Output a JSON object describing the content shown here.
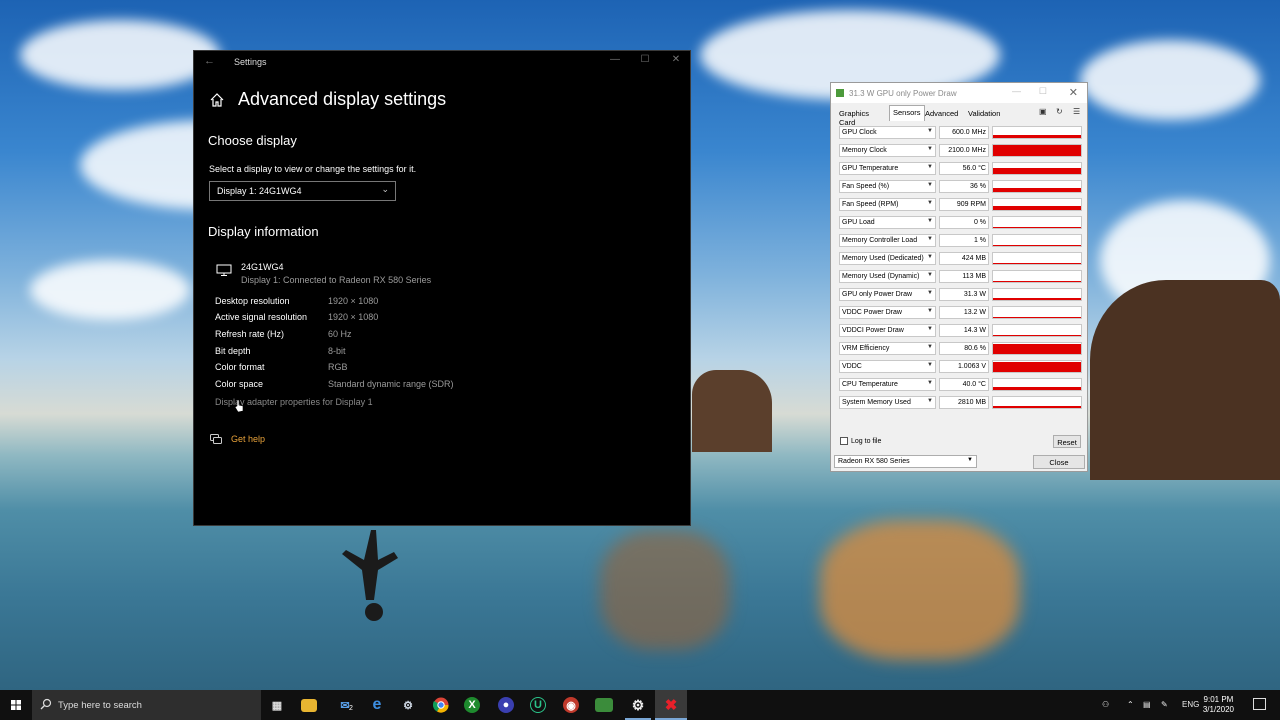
{
  "settings": {
    "window_title": "Settings",
    "page_title": "Advanced display settings",
    "choose_display_heading": "Choose display",
    "choose_display_desc": "Select a display to view or change the settings for it.",
    "display_select_value": "Display 1: 24G1WG4",
    "display_info_heading": "Display information",
    "monitor_name": "24G1WG4",
    "monitor_desc": "Display 1: Connected to Radeon RX 580 Series",
    "info_rows": [
      {
        "label": "Desktop resolution",
        "value": "1920 × 1080"
      },
      {
        "label": "Active signal resolution",
        "value": "1920 × 1080"
      },
      {
        "label": "Refresh rate (Hz)",
        "value": "60 Hz"
      },
      {
        "label": "Bit depth",
        "value": "8-bit"
      },
      {
        "label": "Color format",
        "value": "RGB"
      },
      {
        "label": "Color space",
        "value": "Standard dynamic range (SDR)"
      }
    ],
    "adapter_link": "Display adapter properties for Display 1",
    "get_help": "Get help"
  },
  "gpuz": {
    "title": "31.3 W GPU only Power Draw",
    "tabs": [
      "Graphics Card",
      "Sensors",
      "Advanced",
      "Validation"
    ],
    "active_tab": "Sensors",
    "sensors": [
      {
        "name": "GPU Clock",
        "value": "600.0 MHz",
        "level": 0.3
      },
      {
        "name": "Memory Clock",
        "value": "2100.0 MHz",
        "level": 1.0
      },
      {
        "name": "GPU Temperature",
        "value": "56.0 °C",
        "level": 0.55
      },
      {
        "name": "Fan Speed (%)",
        "value": "36 %",
        "level": 0.35
      },
      {
        "name": "Fan Speed (RPM)",
        "value": "909 RPM",
        "level": 0.35
      },
      {
        "name": "GPU Load",
        "value": "0 %",
        "level": 0.05
      },
      {
        "name": "Memory Controller Load",
        "value": "1 %",
        "level": 0.03
      },
      {
        "name": "Memory Used (Dedicated)",
        "value": "424 MB",
        "level": 0.08
      },
      {
        "name": "Memory Used (Dynamic)",
        "value": "113 MB",
        "level": 0.05
      },
      {
        "name": "GPU only Power Draw",
        "value": "31.3 W",
        "level": 0.2
      },
      {
        "name": "VDDC Power Draw",
        "value": "13.2 W",
        "level": 0.1
      },
      {
        "name": "VDDCI Power Draw",
        "value": "14.3 W",
        "level": 0.1
      },
      {
        "name": "VRM Efficiency",
        "value": "80.6 %",
        "level": 0.95
      },
      {
        "name": "VDDC",
        "value": "1.0063 V",
        "level": 0.9
      },
      {
        "name": "CPU Temperature",
        "value": "40.0 °C",
        "level": 0.3
      },
      {
        "name": "System Memory Used",
        "value": "2810 MB",
        "level": 0.2
      }
    ],
    "log_to_file": "Log to file",
    "reset": "Reset",
    "gpu_select": "Radeon RX 580 Series",
    "close": "Close"
  },
  "taskbar": {
    "search_placeholder": "Type here to search",
    "lang": "ENG",
    "time": "9:01 PM",
    "date": "3/1/2020",
    "mail_badge": "2"
  },
  "colors": {
    "graph_red": "#e00000",
    "link_orange": "#e8a23a"
  }
}
